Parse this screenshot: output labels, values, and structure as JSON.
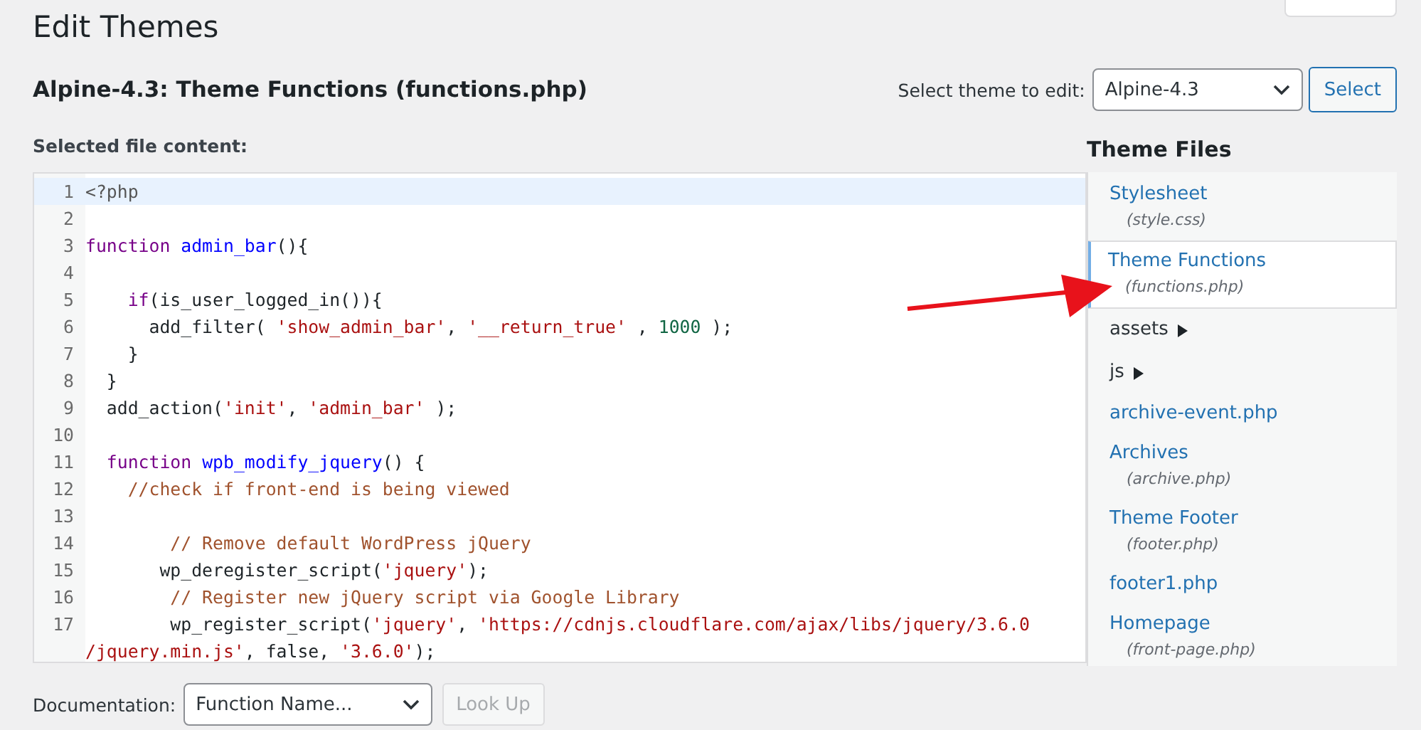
{
  "page_title": "Edit Themes",
  "file_heading": "Alpine-4.3: Theme Functions (functions.php)",
  "theme_select": {
    "label": "Select theme to edit:",
    "value": "Alpine-4.3",
    "button": "Select"
  },
  "editor": {
    "label": "Selected file content:",
    "lines": [
      {
        "number": "1",
        "active": true,
        "tokens": [
          {
            "text": "<?php",
            "kind": "meta"
          }
        ]
      },
      {
        "number": "2",
        "active": false
      },
      {
        "number": "3",
        "active": false,
        "tokens": [
          {
            "text": "function ",
            "kind": "keyword"
          },
          {
            "text": "admin_bar",
            "kind": "def"
          },
          {
            "text": "(){",
            "kind": "plain"
          }
        ]
      },
      {
        "number": "4",
        "active": false
      },
      {
        "number": "5",
        "active": false,
        "tokens": [
          {
            "text": "    if",
            "kind": "keyword"
          },
          {
            "text": "(is_user_logged_in()){",
            "kind": "plain"
          }
        ]
      },
      {
        "number": "6",
        "active": false,
        "tokens": [
          {
            "text": "      add_filter( ",
            "kind": "plain"
          },
          {
            "text": "'show_admin_bar'",
            "kind": "string"
          },
          {
            "text": ", ",
            "kind": "plain"
          },
          {
            "text": "'__return_true'",
            "kind": "string"
          },
          {
            "text": " , ",
            "kind": "plain"
          },
          {
            "text": "1000",
            "kind": "number"
          },
          {
            "text": " );",
            "kind": "plain"
          }
        ]
      },
      {
        "number": "7",
        "active": false,
        "tokens": [
          {
            "text": "    }",
            "kind": "plain"
          }
        ]
      },
      {
        "number": "8",
        "active": false,
        "tokens": [
          {
            "text": "  }",
            "kind": "plain"
          }
        ]
      },
      {
        "number": "9",
        "active": false,
        "tokens": [
          {
            "text": "  add_action(",
            "kind": "plain"
          },
          {
            "text": "'init'",
            "kind": "string"
          },
          {
            "text": ", ",
            "kind": "plain"
          },
          {
            "text": "'admin_bar'",
            "kind": "string"
          },
          {
            "text": " );",
            "kind": "plain"
          }
        ]
      },
      {
        "number": "10",
        "active": false
      },
      {
        "number": "11",
        "active": false,
        "tokens": [
          {
            "text": "  function ",
            "kind": "keyword"
          },
          {
            "text": "wpb_modify_jquery",
            "kind": "def"
          },
          {
            "text": "() {",
            "kind": "plain"
          }
        ]
      },
      {
        "number": "12",
        "active": false,
        "tokens": [
          {
            "text": "    //check if front-end is being viewed",
            "kind": "comment"
          }
        ]
      },
      {
        "number": "13",
        "active": false
      },
      {
        "number": "14",
        "active": false,
        "tokens": [
          {
            "text": "        // Remove default WordPress jQuery",
            "kind": "comment"
          }
        ]
      },
      {
        "number": "15",
        "active": false,
        "tokens": [
          {
            "text": "       wp_deregister_script(",
            "kind": "plain"
          },
          {
            "text": "'jquery'",
            "kind": "string"
          },
          {
            "text": ");",
            "kind": "plain"
          }
        ]
      },
      {
        "number": "16",
        "active": false,
        "tokens": [
          {
            "text": "        // Register new jQuery script via Google Library",
            "kind": "comment"
          }
        ]
      },
      {
        "number": "17",
        "active": false,
        "tokens": [
          {
            "text": "        wp_register_script(",
            "kind": "plain"
          },
          {
            "text": "'jquery'",
            "kind": "string"
          },
          {
            "text": ", ",
            "kind": "plain"
          },
          {
            "text": "'https://cdnjs.cloudflare.com/ajax/libs/jquery/3.6.0",
            "kind": "string"
          }
        ]
      },
      {
        "active": false,
        "tokens": [
          {
            "text": "/jquery.min.js'",
            "kind": "string"
          },
          {
            "text": ", false, ",
            "kind": "plain"
          },
          {
            "text": "'3.6.0'",
            "kind": "string"
          },
          {
            "text": ");",
            "kind": "plain"
          }
        ]
      }
    ]
  },
  "theme_files": {
    "heading": "Theme Files",
    "items": [
      {
        "kind": "file",
        "name": "Stylesheet",
        "file": "(style.css)",
        "selected": false
      },
      {
        "kind": "file",
        "name": "Theme Functions",
        "file": "(functions.php)",
        "selected": true
      },
      {
        "kind": "folder",
        "name": "assets",
        "selected": false
      },
      {
        "kind": "folder",
        "name": "js",
        "selected": false
      },
      {
        "kind": "file",
        "name": "archive-event.php",
        "selected": false
      },
      {
        "kind": "file",
        "name": "Archives",
        "file": "(archive.php)",
        "selected": false
      },
      {
        "kind": "file",
        "name": "Theme Footer",
        "file": "(footer.php)",
        "selected": false
      },
      {
        "kind": "file",
        "name": "footer1.php",
        "selected": false
      },
      {
        "kind": "file",
        "name": "Homepage",
        "file": "(front-page.php)",
        "selected": false
      }
    ]
  },
  "documentation": {
    "label": "Documentation:",
    "placeholder": "Function Name...",
    "button": "Look Up",
    "button_disabled": true
  }
}
